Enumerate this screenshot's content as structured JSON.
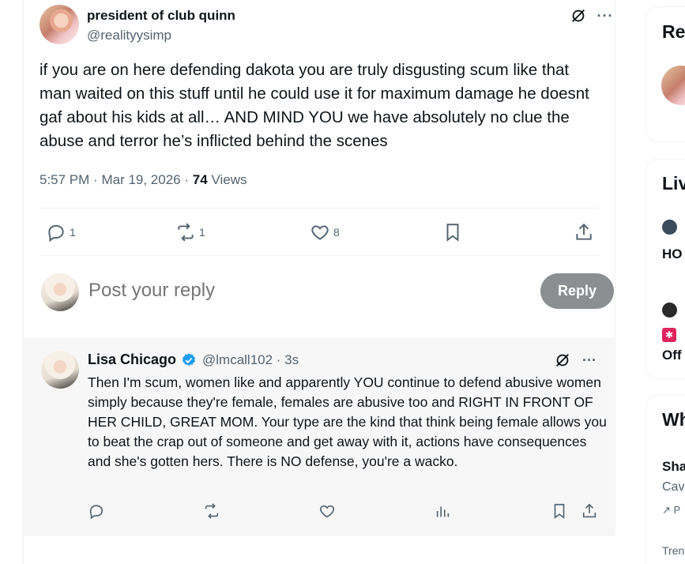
{
  "tweet": {
    "display_name": "president of club quinn",
    "handle": "@realityysimp",
    "text": "if you are on here defending dakota you are truly disgusting scum like that man waited on this stuff until he could use it for maximum damage he doesnt gaf about his kids at all… AND MIND YOU we have absolutely no clue the abuse and terror he’s inflicted behind the scenes",
    "time": "5:57 PM",
    "separator": "·",
    "date": "Mar 19, 2026",
    "views_count": "74",
    "views_label": "Views",
    "replies": "1",
    "reposts": "1",
    "likes": "8"
  },
  "composer": {
    "placeholder": "Post your reply",
    "reply_label": "Reply"
  },
  "reply": {
    "display_name": "Lisa Chicago",
    "handle_time": "@lmcall102 · 3s",
    "text": "Then I'm scum, women like and apparently YOU continue to defend abusive women simply because they're female, females are abusive too and RIGHT IN FRONT OF HER CHILD, GREAT MOM. Your type are the kind that think being female allows you to beat the crap out of someone and get away with it, actions have consequences and she's gotten hers. There is NO defense, you're a wacko."
  },
  "sidebar": {
    "card1_title": "Re",
    "card2_title": "Liv",
    "live1_text": "HO",
    "live2_text": "Off",
    "card3_title": "Wh",
    "trend_title": "Sha",
    "trend_sub": "Cav",
    "trend_promo": "P",
    "trend_footer": "Tren"
  },
  "colors": {
    "accent": "#1d9bf0",
    "muted": "#536471",
    "reply_button": "#8b8f92"
  }
}
